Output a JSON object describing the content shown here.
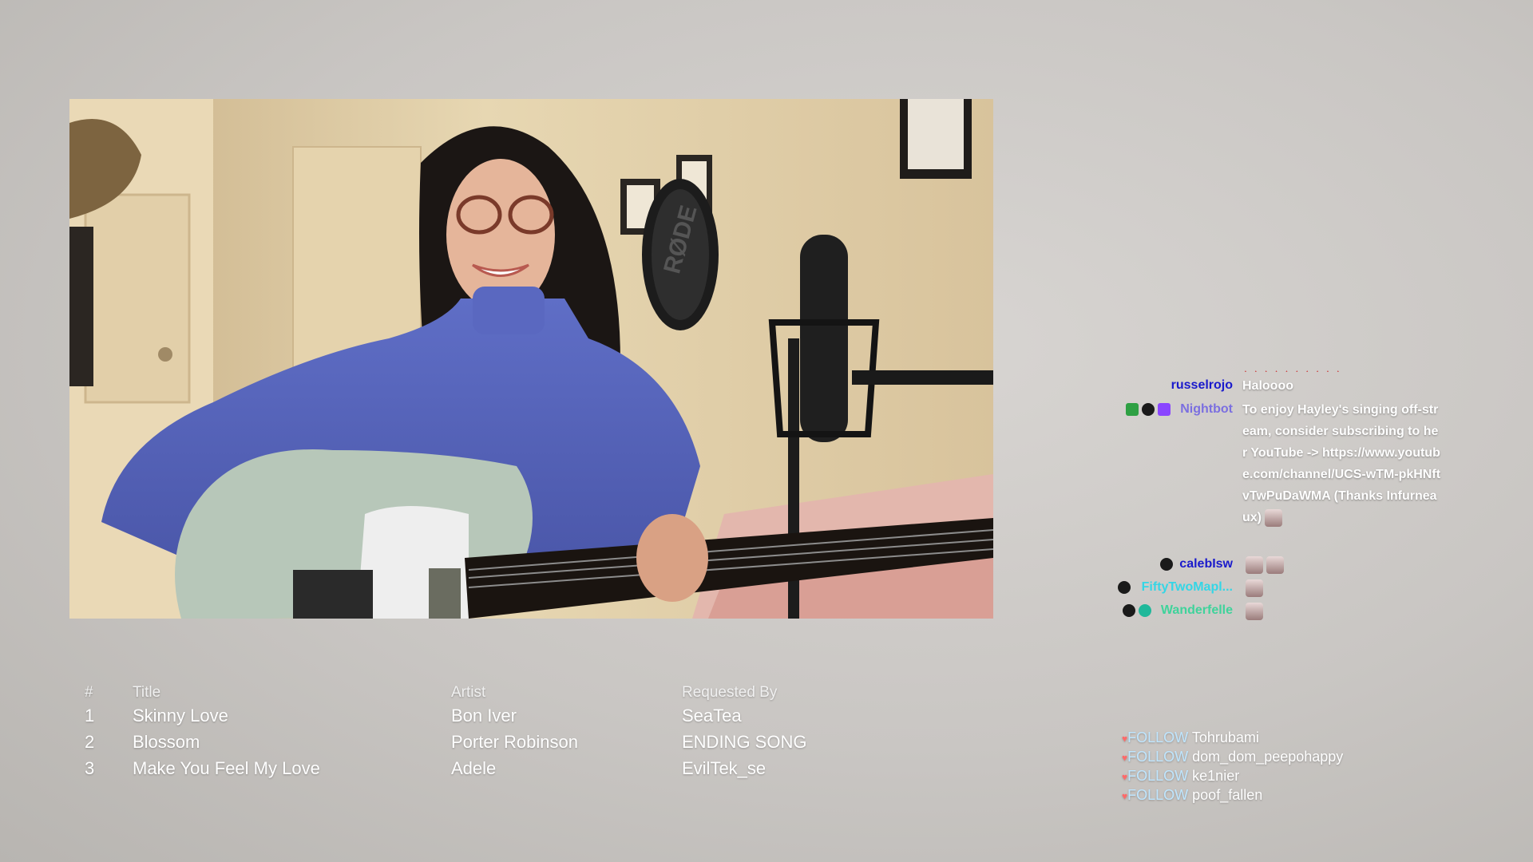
{
  "queue": {
    "headers": {
      "num": "#",
      "title": "Title",
      "artist": "Artist",
      "requested_by": "Requested By"
    },
    "rows": [
      {
        "num": "1",
        "title": "Skinny Love",
        "artist": "Bon Iver",
        "requested_by": "SeaTea"
      },
      {
        "num": "2",
        "title": "Blossom",
        "artist": "Porter Robinson",
        "requested_by": "ENDING SONG"
      },
      {
        "num": "3",
        "title": "Make You Feel My Love",
        "artist": "Adele",
        "requested_by": "EvilTek_se"
      }
    ]
  },
  "chat": {
    "messages": [
      {
        "user": "russelrojo",
        "color": "#1a1acc",
        "text": "Haloooo"
      },
      {
        "user": "Nightbot",
        "color": "#7b6fe0",
        "text": "To enjoy Hayley's singing off-stream, consider subscribing to her YouTube -> https://www.youtube.com/channel/UCS-wTM-pkHNftvTwPuDaWMA (Thanks Infurneaux)"
      },
      {
        "user": "calebIsw",
        "color": "#1a1acc",
        "text": ""
      },
      {
        "user": "FiftyTwoMapl...",
        "color": "#34d6e6",
        "text": ""
      },
      {
        "user": "Wanderfelle",
        "color": "#3fd39b",
        "text": ""
      }
    ]
  },
  "follows": {
    "label": "FOLLOW",
    "heart_icon": "heart-icon",
    "names": [
      "Tohrubami",
      "dom_dom_peepohappy",
      "ke1nier",
      "poof_fallen"
    ]
  },
  "webcam": {
    "mic_brand": "RØDE"
  }
}
